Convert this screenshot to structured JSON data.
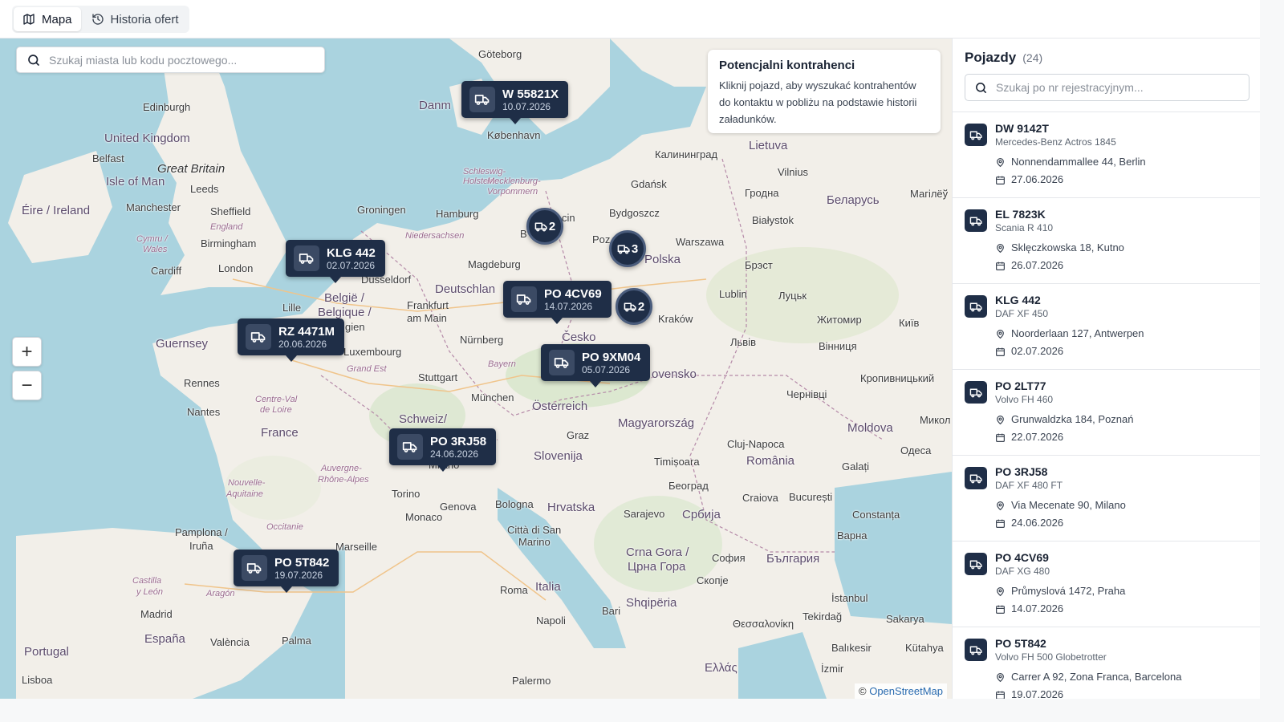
{
  "tabs": [
    {
      "label": "Mapa",
      "icon": "map-icon",
      "active": true
    },
    {
      "label": "Historia ofert",
      "icon": "history-icon",
      "active": false
    }
  ],
  "map_search": {
    "placeholder": "Szukaj miasta lub kodu pocztowego..."
  },
  "info": {
    "title": "Potencjalni kontrahenci",
    "text": "Kliknij pojazd, aby wyszukać kontrahentów do kontaktu w pobliżu na podstawie historii załadunków."
  },
  "zoom": {
    "in": "+",
    "out": "−"
  },
  "attribution": {
    "prefix": "©",
    "link": "OpenStreetMap"
  },
  "map_labels": {
    "goteborg": "Göteborg",
    "danmark": "Danm",
    "kobenhavn": "København",
    "edinburgh": "Edinburgh",
    "uk": "United Kingdom",
    "belfast": "Belfast",
    "great_britain": "Great Britain",
    "isle_of_man": "Isle of Man",
    "leeds": "Leeds",
    "eire": "Éire / Ireland",
    "manchester": "Manchester",
    "sheffield": "Sheffield",
    "cymru": "Cymru /",
    "wales": "Wales",
    "birmingham": "Birmingham",
    "england": "England",
    "london": "London",
    "cardiff": "Cardiff",
    "groningen": "Groningen",
    "hamburg": "Hamburg",
    "niedersachsen": "Niedersachsen",
    "magdeburg": "Magdeburg",
    "dusseldorf": "Düsseldorf",
    "deutschland": "Deutschlan",
    "belgie": "België /",
    "belgique": "Belgique /",
    "lille": "Lille",
    "frankfurt": "Frankfurt",
    "am_main": "am Main",
    "luxembourg": "Luxembourg",
    "grand_est": "Grand Est",
    "nurnberg": "Nürnberg",
    "bayern": "Bayern",
    "stuttgart": "Stuttgart",
    "munchen": "München",
    "guernsey": "Guernsey",
    "rennes": "Rennes",
    "centre": "Centre-Val",
    "de_loire": "de Loire",
    "nantes": "Nantes",
    "france": "France",
    "schweiz": "Schweiz/",
    "osterreich": "Österreich",
    "graz": "Graz",
    "slovenija": "Slovenija",
    "auvergne": "Auvergne-",
    "rhone": "Rhône-Alpes",
    "nouvelle": "Nouvelle-",
    "aquitaine": "Aquitaine",
    "torino": "Torino",
    "genova": "Genova",
    "bologna": "Bologna",
    "monaco": "Monaco",
    "occitanie": "Occitanie",
    "marseille": "Marseille",
    "san_marino": "Città di San",
    "marino": "Marino",
    "hrvatska": "Hrvatska",
    "pamplona": "Pamplona /",
    "iruna": "Iruña",
    "castilla": "Castilla",
    "y_leon": "y León",
    "aragon": "Aragón",
    "madrid": "Madrid",
    "espana": "España",
    "valencia": "València",
    "palma": "Palma",
    "portugal": "Portugal",
    "lisboa": "Lisboa",
    "italia": "Italia",
    "roma": "Roma",
    "napoli": "Napoli",
    "bari": "Bari",
    "palermo": "Palermo",
    "sarajevo": "Sarajevo",
    "srbija": "Србија",
    "beograd": "Београд",
    "timisoara": "Timișoara",
    "magyar": "Magyarország",
    "cluj": "Cluj-Napoca",
    "romania": "România",
    "bucuresti": "București",
    "craiova": "Craiova",
    "constanta": "Constanța",
    "varna": "Варна",
    "bulgaria": "България",
    "sofia": "София",
    "crna_gora": "Crna Gora /",
    "crna_gora2": "Црна Гора",
    "skopje": "Скопје",
    "shqiperia": "Shqipëria",
    "thessaloniki": "Θεσσαλονίκη",
    "ellas": "Ελλάς",
    "istanbul": "İstanbul",
    "tekirdag": "Tekirdağ",
    "sakarya": "Sakarya",
    "balikesir": "Balıkesir",
    "kutahya": "Kütahya",
    "izmir": "İzmir",
    "kaliningrad": "Калининград",
    "lietuva": "Lietuva",
    "vilnius": "Vilnius",
    "gdansk": "Gdańsk",
    "grodna": "Гродна",
    "belarus": "Беларусь",
    "mahilyow": "Магілёў",
    "bydgoszcz": "Bydgoszcz",
    "bialystok": "Białystok",
    "warszawa": "Warszawa",
    "polska": "Polska",
    "brest": "Брэст",
    "lublin": "Lublin",
    "lutsk": "Луцьк",
    "krakow": "Kraków",
    "zhytomyr": "Житомир",
    "kyiv": "Київ",
    "lviv": "Львів",
    "vinnytsia": "Вінниця",
    "cesko": "Česko",
    "slovensko": "ovensko",
    "kropyvnytskyi": "Кропивницький",
    "chernivtsi": "Чернівці",
    "moldova": "Moldova",
    "mykola": "Микол",
    "odesa": "Одеса",
    "galati": "Galați",
    "szczecin": "cin",
    "poznan": "Poz",
    "berlin": "B",
    "schleswig": "Schleswig-",
    "holstein": "Holstein",
    "mecklenburg": "Mecklenburg-",
    "vorpommern": "Vorpommern",
    "milano": "Milano",
    "gien": "gien"
  },
  "pins": [
    {
      "plate": "W 55821X",
      "date": "10.07.2026"
    },
    {
      "plate": "KLG 442",
      "date": "02.07.2026"
    },
    {
      "plate": "RZ 4471M",
      "date": "20.06.2026"
    },
    {
      "plate": "PO 4CV69",
      "date": "14.07.2026"
    },
    {
      "plate": "PO 9XM04",
      "date": "05.07.2026"
    },
    {
      "plate": "PO 3RJ58",
      "date": "24.06.2026"
    },
    {
      "plate": "PO 5T842",
      "date": "19.07.2026"
    }
  ],
  "clusters": [
    {
      "count": "2"
    },
    {
      "count": "3"
    },
    {
      "count": "2"
    }
  ],
  "panel": {
    "title": "Pojazdy",
    "count": "(24)",
    "search_placeholder": "Szukaj po nr rejestracyjnym...",
    "vehicles": [
      {
        "plate": "DW 9142T",
        "model": "Mercedes-Benz Actros 1845",
        "address": "Nonnendammallee 44, Berlin",
        "date": "27.06.2026"
      },
      {
        "plate": "EL 7823K",
        "model": "Scania R 410",
        "address": "Sklęczkowska 18, Kutno",
        "date": "26.07.2026"
      },
      {
        "plate": "KLG 442",
        "model": "DAF XF 450",
        "address": "Noorderlaan 127, Antwerpen",
        "date": "02.07.2026"
      },
      {
        "plate": "PO 2LT77",
        "model": "Volvo FH 460",
        "address": "Grunwaldzka 184, Poznań",
        "date": "22.07.2026"
      },
      {
        "plate": "PO 3RJ58",
        "model": "DAF XF 480 FT",
        "address": "Via Mecenate 90, Milano",
        "date": "24.06.2026"
      },
      {
        "plate": "PO 4CV69",
        "model": "DAF XG 480",
        "address": "Průmyslová 1472, Praha",
        "date": "14.07.2026"
      },
      {
        "plate": "PO 5T842",
        "model": "Volvo FH 500 Globetrotter",
        "address": "Carrer A 92, Zona Franca, Barcelona",
        "date": "19.07.2026"
      }
    ]
  },
  "colors": {
    "pin_bg": "#1f2e47",
    "water": "#aad3df",
    "land": "#f2efe9",
    "link": "#2b6cb0"
  }
}
